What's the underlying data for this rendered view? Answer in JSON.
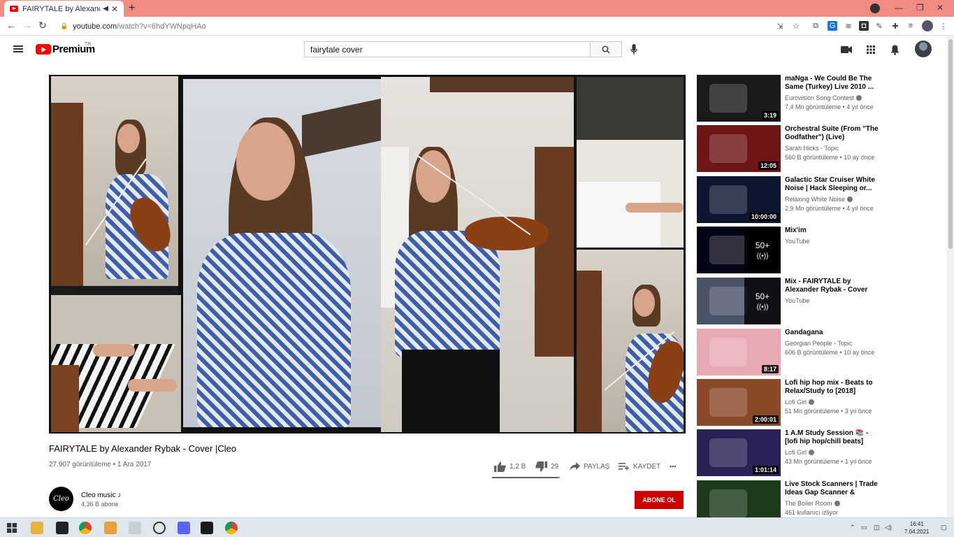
{
  "browser": {
    "tab_title": "FAIRYTALE by Alexander Ryb",
    "url_host": "youtube.com",
    "url_path": "/watch?v=6hdYWNpqHAo"
  },
  "youtube": {
    "logo_text": "Premium",
    "logo_region": "TR",
    "search_value": "fairytale cover"
  },
  "video": {
    "title": "FAIRYTALE by Alexander Rybak - Cover |Cleo",
    "meta": "27.907 görüntüleme • 1 Ara 2017",
    "likes": "1,2 B",
    "dislikes": "29",
    "like_ratio": 0.97,
    "share_label": "PAYLAŞ",
    "save_label": "KAYDET",
    "more_label": "•••"
  },
  "channel": {
    "name": "Cleo music ♪",
    "subs": "4,36 B abone",
    "subscribe_label": "ABONE OL",
    "avatar_text": "Cleo"
  },
  "recommendations": [
    {
      "title": "maNga - We Could Be The Same (Turkey) Live 2010 ...",
      "channel": "Eurovision Song Contest",
      "verified": true,
      "views": "7,4 Mn görüntüleme • 4 yıl önce",
      "duration": "3:19",
      "thumb_bg": "#1a1a1a"
    },
    {
      "title": "Orchestral Suite (From \"The Godfather\") (Live)",
      "channel": "Sarah Hicks - Topic",
      "verified": false,
      "views": "560 B görüntüleme • 10 ay önce",
      "duration": "12:05",
      "thumb_bg": "#6e1515"
    },
    {
      "title": "Galactic Star Cruiser White Noise | Hack Sleeping or...",
      "channel": "Relaxing White Noise",
      "verified": true,
      "views": "2,9 Mn görüntüleme • 4 yıl önce",
      "duration": "10:00:00",
      "thumb_bg": "#0d1630"
    },
    {
      "title": "Mix'im",
      "channel": "YouTube",
      "verified": false,
      "views": "",
      "duration": "",
      "mix_count": "50+",
      "thumb_bg": "#050518"
    },
    {
      "title": "Mix - FAIRYTALE by Alexander Rybak - Cover |Cleo",
      "channel": "YouTube",
      "verified": false,
      "views": "",
      "duration": "",
      "mix_count": "50+",
      "thumb_bg": "#4a5368"
    },
    {
      "title": "Gandagana",
      "channel": "Georgian People - Topic",
      "verified": false,
      "views": "606 B görüntüleme • 10 ay önce",
      "duration": "8:17",
      "thumb_bg": "#e8aab2"
    },
    {
      "title": "Lofi hip hop mix - Beats to Relax/Study to [2018]",
      "channel": "Lofi Girl",
      "verified": true,
      "views": "51 Mn görüntüleme • 3 yıl önce",
      "duration": "2:00:01",
      "thumb_bg": "#8a4a2a"
    },
    {
      "title": "1 A.M Study Session 📚 - [lofi hip hop/chill beats]",
      "channel": "Lofi Girl",
      "verified": true,
      "views": "43 Mn görüntüleme • 1 yıl önce",
      "duration": "1:01:14",
      "thumb_bg": "#2a2156"
    },
    {
      "title": "Live Stock Scanners | Trade Ideas Gap Scanner & Penny...",
      "channel": "The Boiler Room",
      "verified": true,
      "views": "461 kullanıcı izliyor",
      "duration": "",
      "thumb_bg": "#1d3a1d"
    }
  ],
  "taskbar": {
    "time": "16:41",
    "date": "7.04.2021"
  }
}
